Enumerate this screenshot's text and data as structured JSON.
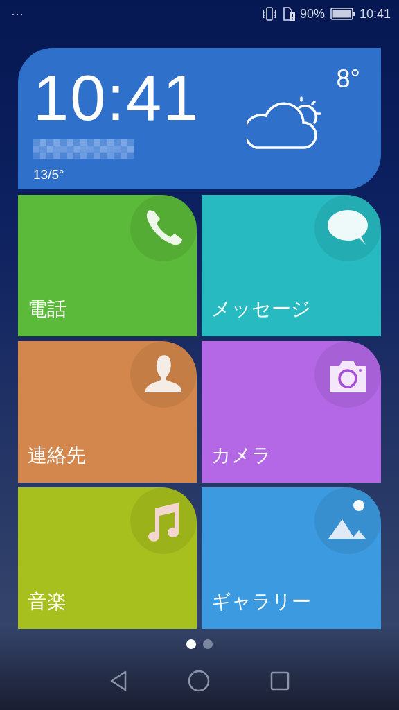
{
  "status_bar": {
    "overflow": "···",
    "battery_percent": "90%",
    "time": "10:41"
  },
  "clock_widget": {
    "time": "10:41",
    "range": "13/5°",
    "temperature": "8°"
  },
  "tiles": [
    {
      "label": "電話",
      "kind": "phone",
      "color": "#5bba3a"
    },
    {
      "label": "メッセージ",
      "kind": "message",
      "color": "#27bac1"
    },
    {
      "label": "連絡先",
      "kind": "contact",
      "color": "#d4874c"
    },
    {
      "label": "カメラ",
      "kind": "camera",
      "color": "#b468e6"
    },
    {
      "label": "音楽",
      "kind": "music",
      "color": "#a8c01e"
    },
    {
      "label": "ギャラリー",
      "kind": "gallery",
      "color": "#3c9ae0"
    }
  ],
  "page_dots": [
    {
      "selected": true
    },
    {
      "selected": false
    }
  ]
}
